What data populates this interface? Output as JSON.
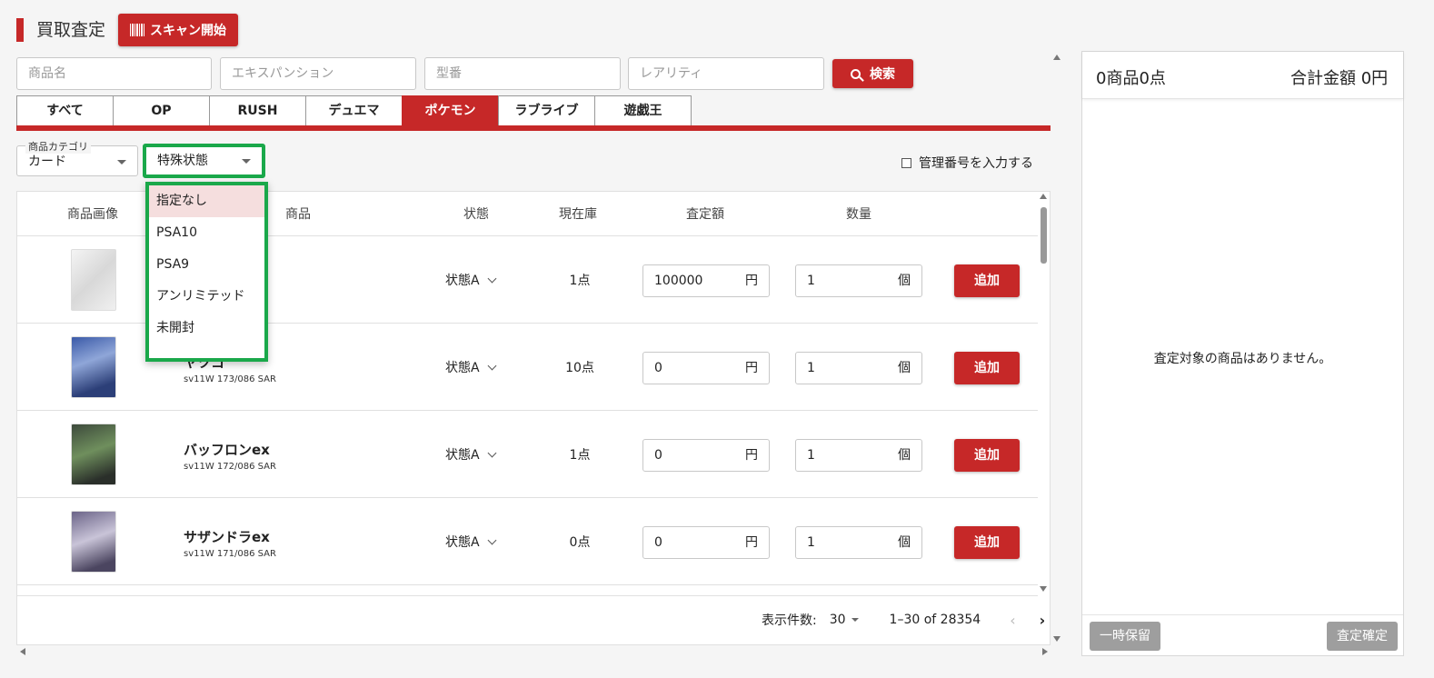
{
  "header": {
    "title": "買取査定",
    "scan_label": "スキャン開始"
  },
  "search": {
    "name_placeholder": "商品名",
    "expansion_placeholder": "エキスパンション",
    "model_placeholder": "型番",
    "rarity_placeholder": "レアリティ",
    "button_label": "検索"
  },
  "tabs": [
    {
      "label": "すべて"
    },
    {
      "label": "OP"
    },
    {
      "label": "RUSH"
    },
    {
      "label": "デュエマ"
    },
    {
      "label": "ポケモン",
      "active": true
    },
    {
      "label": "ラブライブ"
    },
    {
      "label": "遊戯王"
    }
  ],
  "filters": {
    "category_label": "商品カテゴリ",
    "category_value": "カード",
    "special_value": "特殊状態",
    "manage_label": "管理番号を入力する"
  },
  "dropdown": {
    "items": [
      "指定なし",
      "PSA10",
      "PSA9",
      "アンリミテッド",
      "未開封"
    ]
  },
  "table": {
    "headers": [
      "商品画像",
      "商品",
      "状態",
      "現在庫",
      "査定額",
      "数量"
    ],
    "rows": [
      {
        "name": "",
        "code": "",
        "state": "状態A",
        "stock": "1点",
        "amount": "100000",
        "yen": "円",
        "qty": "1",
        "unit": "個",
        "add": "追加"
      },
      {
        "name": "ヤツコ",
        "code": "sv11W 173/086 SAR",
        "state": "状態A",
        "stock": "10点",
        "amount": "0",
        "yen": "円",
        "qty": "1",
        "unit": "個",
        "add": "追加"
      },
      {
        "name": "バッフロンex",
        "code": "sv11W 172/086 SAR",
        "state": "状態A",
        "stock": "1点",
        "amount": "0",
        "yen": "円",
        "qty": "1",
        "unit": "個",
        "add": "追加"
      },
      {
        "name": "サザンドラex",
        "code": "sv11W 171/086 SAR",
        "state": "状態A",
        "stock": "0点",
        "amount": "0",
        "yen": "円",
        "qty": "1",
        "unit": "個",
        "add": "追加"
      }
    ]
  },
  "pager": {
    "per_page_label": "表示件数:",
    "per_page": "30",
    "range": "1–30 of 28354"
  },
  "panel": {
    "count": "0商品0点",
    "total": "合計金額 0円",
    "empty": "査定対象の商品はありません。",
    "hold_label": "一時保留",
    "confirm_label": "査定確定"
  },
  "colors": {
    "brand": "#c62828",
    "highlight": "#1aa84a"
  }
}
